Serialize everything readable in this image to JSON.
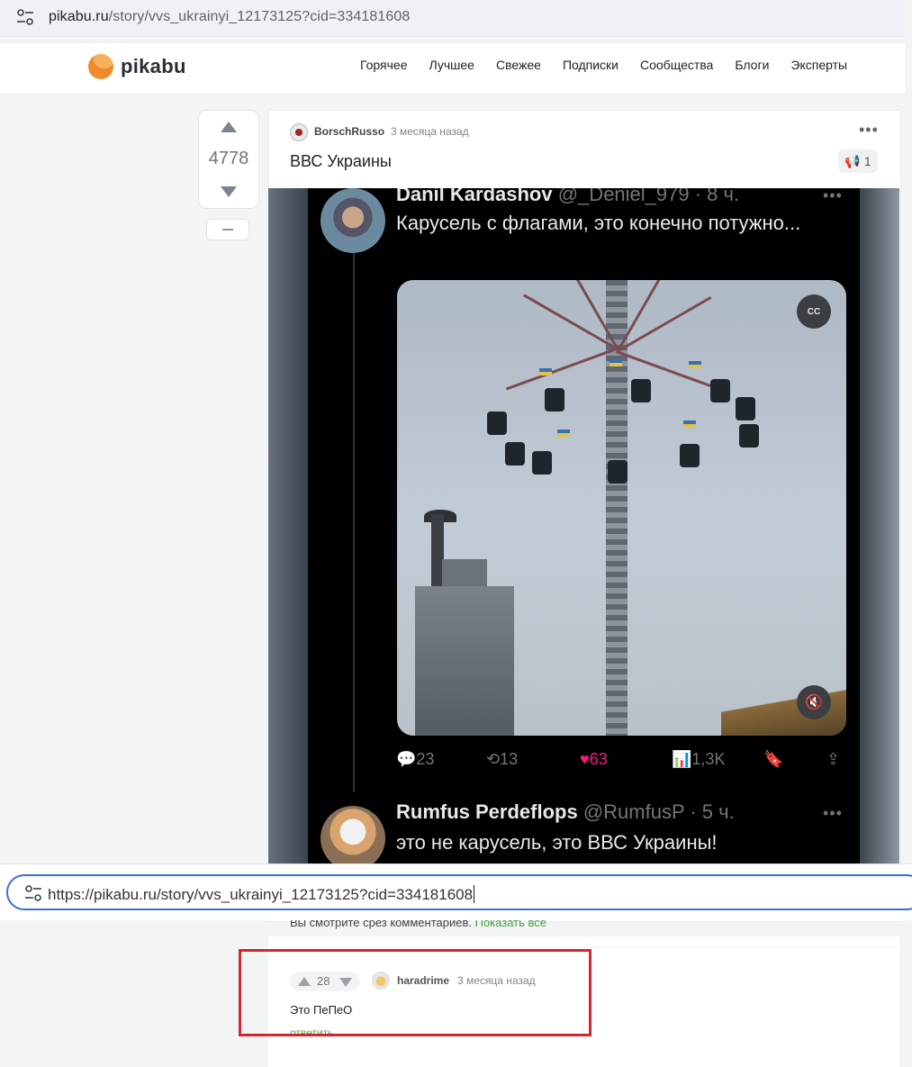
{
  "browser": {
    "host": "pikabu.ru",
    "path": "/story/vvs_ukrainyi_12173125?cid=334181608",
    "icon": "tune-icon"
  },
  "header": {
    "logo": "pikabu",
    "nav": [
      "Горячее",
      "Лучшее",
      "Свежее",
      "Подписки",
      "Сообщества",
      "Блоги",
      "Эксперты"
    ]
  },
  "post": {
    "rating": "4778",
    "author": "BorschRusso",
    "time": "3 месяца назад",
    "title": "ВВС Украины",
    "badge_count": "1",
    "tweet1": {
      "name": "Danil Kardashov",
      "handle": "@_Deniel_979 · 8 ч.",
      "text": "Карусель с флагами, это конечно потужно...",
      "cc": "CC",
      "replies": "23",
      "retweets": "13",
      "likes": "63",
      "views": "1,3K"
    },
    "tweet2": {
      "name": "Rumfus Perdeflops",
      "handle": "@RumfusP · 5 ч.",
      "text": "это не карусель, это ВВС Украины!"
    }
  },
  "address_popup": {
    "value": "https://pikabu.ru/story/vvs_ukrainyi_12173125?cid=334181608"
  },
  "comments": {
    "slice_text": "Вы смотрите срез комментариев.",
    "show_all": "Показать все",
    "comment": {
      "score": "28",
      "author": "haradrime",
      "time": "3 месяца назад",
      "text": "Это ПеПеО",
      "reply": "ответить"
    }
  },
  "colors": {
    "highlight": "#d7262b",
    "accent_green": "#4a9c3c",
    "like_pink": "#f91880"
  }
}
